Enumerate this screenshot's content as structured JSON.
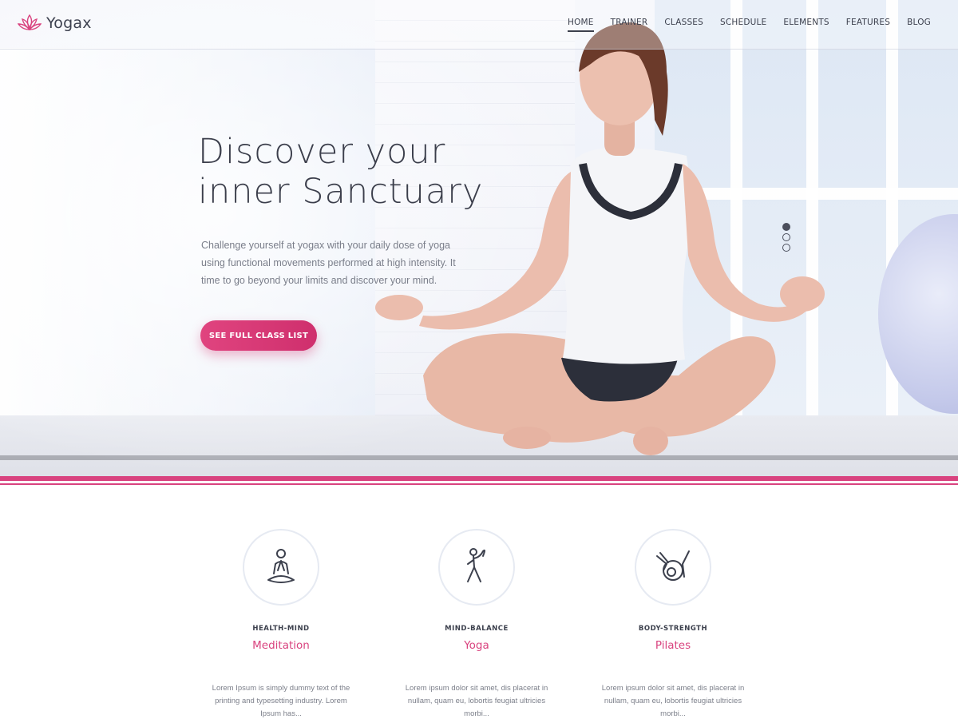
{
  "brand": {
    "name": "Yogax",
    "accent": "#d9437f",
    "logo_icon": "lotus-icon"
  },
  "nav": {
    "items": [
      {
        "label": "HOME",
        "active": true
      },
      {
        "label": "TRAINER"
      },
      {
        "label": "CLASSES"
      },
      {
        "label": "SCHEDULE"
      },
      {
        "label": "ELEMENTS"
      },
      {
        "label": "FEATURES"
      },
      {
        "label": "BLOG"
      }
    ]
  },
  "hero": {
    "headline_line1": "Discover your",
    "headline_line2": "inner Sanctuary",
    "description": "Challenge yourself at yogax with your daily dose of yoga using functional movements performed at high intensity. It time to go beyond your limits and discover your mind.",
    "cta_label": "SEE FULL CLASS LIST",
    "slider_dots": 3,
    "active_slide": 1
  },
  "features": [
    {
      "icon": "meditation-icon",
      "kicker": "HEALTH-MIND",
      "name": "Meditation",
      "description": "Lorem Ipsum is simply dummy text of the printing and typesetting industry. Lorem Ipsum has..."
    },
    {
      "icon": "yoga-pose-icon",
      "kicker": "MIND-BALANCE",
      "name": "Yoga",
      "description": "Lorem ipsum dolor sit amet, dis placerat in nullam, quam eu, lobortis feugiat ultricies morbi..."
    },
    {
      "icon": "pilates-ball-icon",
      "kicker": "BODY-STRENGTH",
      "name": "Pilates",
      "description": "Lorem ipsum dolor sit amet, dis placerat in nullam, quam eu, lobortis feugiat ultricies morbi..."
    }
  ]
}
